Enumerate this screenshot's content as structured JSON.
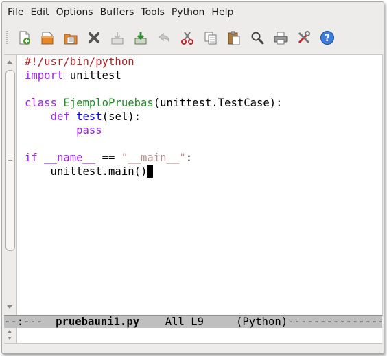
{
  "menubar": {
    "items": [
      "File",
      "Edit",
      "Options",
      "Buffers",
      "Tools",
      "Python",
      "Help"
    ]
  },
  "toolbar": {
    "buttons": [
      {
        "icon": "new-file-icon"
      },
      {
        "icon": "open-file-icon"
      },
      {
        "icon": "open-directory-icon"
      },
      {
        "icon": "close-buffer-icon"
      },
      {
        "icon": "save-icon"
      },
      {
        "icon": "save-as-icon"
      },
      {
        "icon": "undo-icon"
      },
      {
        "icon": "cut-icon"
      },
      {
        "icon": "copy-icon"
      },
      {
        "icon": "paste-icon"
      },
      {
        "icon": "search-icon"
      },
      {
        "icon": "print-icon"
      },
      {
        "icon": "preferences-icon"
      },
      {
        "icon": "help-icon"
      }
    ]
  },
  "editor": {
    "lines": [
      {
        "tokens": [
          {
            "t": "#!/usr/bin/python",
            "c": "comment"
          }
        ]
      },
      {
        "tokens": [
          {
            "t": "import",
            "c": "kw"
          },
          {
            "t": " unittest",
            "c": ""
          }
        ]
      },
      {
        "tokens": []
      },
      {
        "tokens": [
          {
            "t": "class",
            "c": "kw"
          },
          {
            "t": " ",
            "c": ""
          },
          {
            "t": "EjemploPruebas",
            "c": "type"
          },
          {
            "t": "(unittest.TestCase):",
            "c": ""
          }
        ]
      },
      {
        "tokens": [
          {
            "t": "    ",
            "c": ""
          },
          {
            "t": "def",
            "c": "kw"
          },
          {
            "t": " ",
            "c": ""
          },
          {
            "t": "test",
            "c": "fn"
          },
          {
            "t": "(sel):",
            "c": ""
          }
        ]
      },
      {
        "tokens": [
          {
            "t": "        ",
            "c": ""
          },
          {
            "t": "pass",
            "c": "kw"
          }
        ]
      },
      {
        "tokens": []
      },
      {
        "tokens": [
          {
            "t": "if",
            "c": "kw"
          },
          {
            "t": " ",
            "c": ""
          },
          {
            "t": "__name__",
            "c": "kw"
          },
          {
            "t": " == ",
            "c": ""
          },
          {
            "t": "\"__main__\"",
            "c": "str"
          },
          {
            "t": ":",
            "c": ""
          }
        ]
      },
      {
        "tokens": [
          {
            "t": "    unittest.main()",
            "c": ""
          }
        ],
        "cursor": true
      }
    ]
  },
  "modeline": {
    "prefix": "--:---  ",
    "buffer_name": "pruebauni1.py",
    "position": "    All L9     ",
    "mode": "(Python)",
    "fill": "-------------------------"
  },
  "colors": {
    "comment": "#b22222",
    "keyword": "#a020f0",
    "type": "#228b22",
    "function": "#0000ff",
    "string": "#bc8f8f"
  }
}
